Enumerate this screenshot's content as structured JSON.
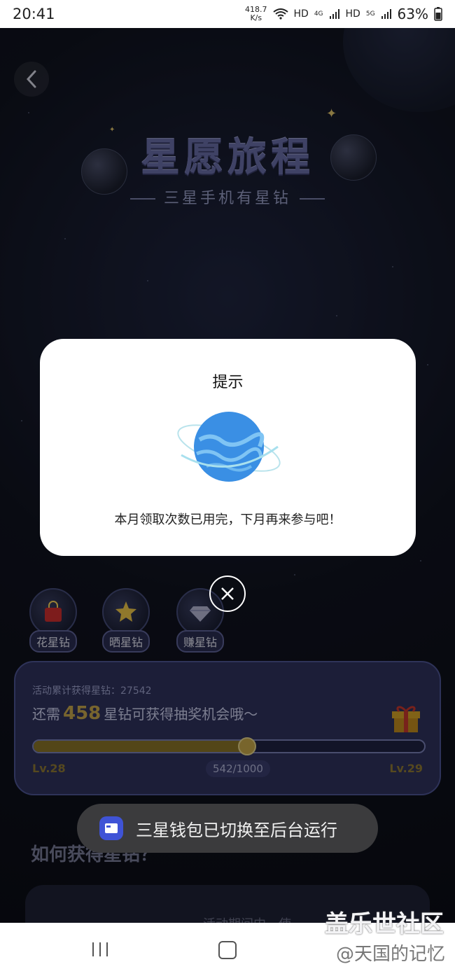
{
  "status_bar": {
    "time": "20:41",
    "speed": "418.7",
    "speed_unit": "K/s",
    "net1": "HD",
    "net2_gen": "4G",
    "net2": "HD",
    "net3_gen": "5G",
    "battery": "63%"
  },
  "header": {
    "title": "星愿旅程",
    "subtitle": "三星手机有星钻"
  },
  "categories": [
    {
      "label": "花星钻",
      "icon": "shopping-bag-icon"
    },
    {
      "label": "晒星钻",
      "icon": "star-icon"
    },
    {
      "label": "赚星钻",
      "icon": "diamond-icon"
    }
  ],
  "progress": {
    "accumulated": "活动累计获得星钻：27542",
    "need_prefix": "还需",
    "need_number": "458",
    "need_suffix": "星钻可获得抽奖机会哦～",
    "ratio": "542/1000",
    "fraction": 0.542,
    "level_left": "Lv.28",
    "level_right": "Lv.29"
  },
  "section": {
    "how_title": "如何获得星钻？",
    "bottom_text": "活动期间内，使..."
  },
  "modal": {
    "title": "提示",
    "message": "本月领取次数已用完，下月再来参与吧！"
  },
  "toast": {
    "text": "三星钱包已切换至后台运行"
  },
  "watermark": {
    "line1": "盖乐世社区",
    "line2": "@天国的记忆"
  },
  "colors": {
    "accent_gold": "#c9a94a",
    "panel_bg": "#2f325e",
    "toast_icon": "#3f53d6"
  }
}
